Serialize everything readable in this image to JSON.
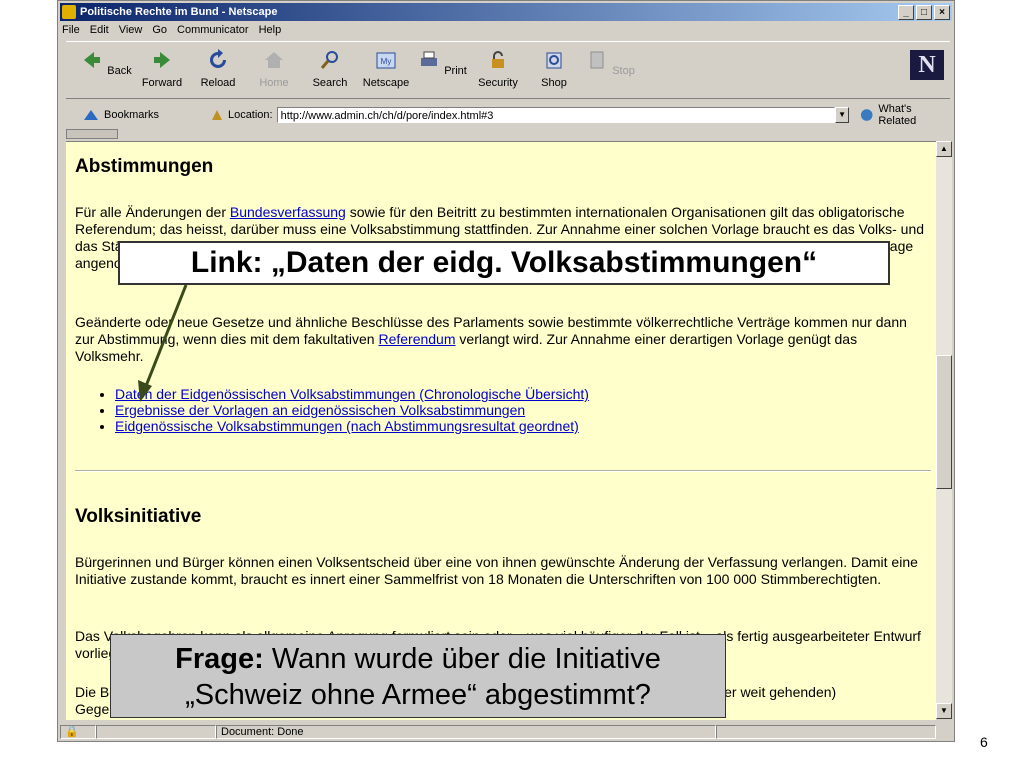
{
  "window": {
    "title": "Politische Rechte im Bund - Netscape",
    "controls": [
      "_",
      "□",
      "×"
    ]
  },
  "menu": [
    "File",
    "Edit",
    "View",
    "Go",
    "Communicator",
    "Help"
  ],
  "toolbar": {
    "buttons": [
      {
        "label": "Back",
        "icon": "back-arrow-icon"
      },
      {
        "label": "Forward",
        "icon": "forward-arrow-icon"
      },
      {
        "label": "Reload",
        "icon": "reload-icon"
      },
      {
        "label": "Home",
        "icon": "home-icon"
      },
      {
        "label": "Search",
        "icon": "search-icon"
      },
      {
        "label": "Netscape",
        "icon": "netscape-icon"
      },
      {
        "label": "Print",
        "icon": "print-icon"
      },
      {
        "label": "Security",
        "icon": "lock-icon"
      },
      {
        "label": "Shop",
        "icon": "shop-icon"
      },
      {
        "label": "Stop",
        "icon": "stop-icon"
      }
    ],
    "logo_text": "N"
  },
  "location": {
    "bookmarks_label": "Bookmarks",
    "location_label": "Location:",
    "url": "http://www.admin.ch/ch/d/pore/index.html#3",
    "related_label": "What's Related"
  },
  "content": {
    "h1": "Abstimmungen",
    "p1_before": "Für alle Änderungen der ",
    "p1_link": "Bundesverfassung",
    "p1_after": " sowie für den Beitritt zu bestimmten internationalen Organisationen gilt das obligatorische Referendum; das heisst, darüber muss eine Volksabstimmung stattfinden. Zur Annahme einer solchen Vorlage braucht es das Volks- und das Ständemehr, also die Mehrheit der Stimmenden und die Mehrheit der Kantone. Stimmberechtigte und Kantone müssen die Vorlage angenommen haben, wobei in den meisten Kantonen die Stimmenden die Vorlage angenommen haben.",
    "p2_before": "Geänderte oder neue Gesetze und ähnliche Beschlüsse des Parlaments sowie bestimmte völkerrechtliche Verträge kommen nur dann zur Abstimmung, wenn dies mit dem fakultativen ",
    "p2_link": "Referendum",
    "p2_after": " verlangt wird. Zur Annahme einer derartigen Vorlage genügt das Volksmehr.",
    "links": [
      "Daten der Eidgenössischen Volksabstimmungen (Chronologische Übersicht)",
      "Ergebnisse der Vorlagen an eidgenössischen Volksabstimmungen",
      "Eidgenössische Volksabstimmungen (nach Abstimmungsresultat geordnet)"
    ],
    "h2": "Volksinitiative",
    "p3": "Bürgerinnen und Bürger können einen Volksentscheid über eine von ihnen gewünschte Änderung der Verfassung verlangen. Damit eine Initiative zustande kommt, braucht es innert einer Sammelfrist von 18 Monaten die Unterschriften von 100 000 Stimmberechtigten.",
    "p4": "Das Volksbegehren kann als allgemeine Anregung formuliert sein oder – was viel häufiger der Fall ist – als fertig ausgearbeiteter Entwurf vorliegen, den Parlament und Regierung nicht mehr verändern können.",
    "p5": "Die Behörden können einer Initiative einen Gegenvorschlag gegenüberstellen, einen direkten oder weniger weit gehenden) Gegenentwurf."
  },
  "status": {
    "text": "Document: Done"
  },
  "callouts": {
    "link_callout": "Link: „Daten der eidg. Volksabstimmungen“",
    "question_bold": "Frage:",
    "question_rest": " Wann wurde über die Initiative",
    "question_line2": "„Schweiz ohne Armee“ abgestimmt?"
  },
  "slide_number": "6"
}
